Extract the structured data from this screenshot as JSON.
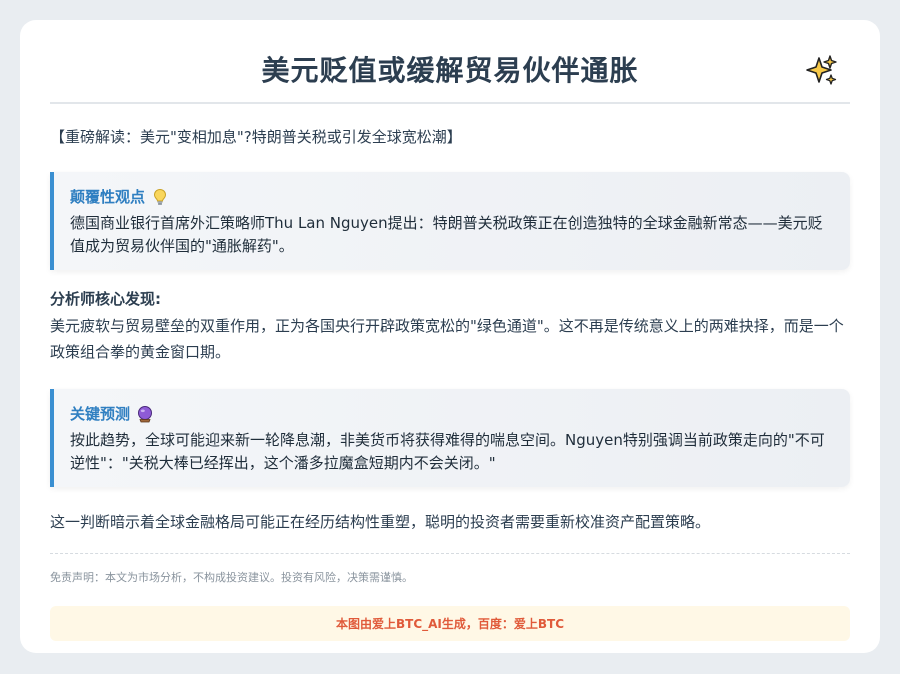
{
  "header": {
    "title": "美元贬值或缓解贸易伙伴通胀",
    "icon": "sparkles-icon"
  },
  "intro": "【重磅解读：美元\"变相加息\"?特朗普关税或引发全球宽松潮】",
  "callout_viewpoint": {
    "heading": "颠覆性观点",
    "icon": "lightbulb-icon",
    "body": "德国商业银行首席外汇策略师Thu Lan Nguyen提出：特朗普关税政策正在创造独特的全球金融新常态——美元贬值成为贸易伙伴国的\"通胀解药\"。"
  },
  "findings": {
    "heading": "分析师核心发现:",
    "body": "美元疲软与贸易壁垒的双重作用，正为各国央行开辟政策宽松的\"绿色通道\"。这不再是传统意义上的两难抉择，而是一个政策组合拳的黄金窗口期。"
  },
  "callout_forecast": {
    "heading": "关键预测",
    "icon": "crystal-ball-icon",
    "body": "按此趋势，全球可能迎来新一轮降息潮，非美货币将获得难得的喘息空间。Nguyen特别强调当前政策走向的\"不可逆性\"：\"关税大棒已经挥出，这个潘多拉魔盒短期内不会关闭。\""
  },
  "closing": "这一判断暗示着全球金融格局可能正在经历结构性重塑，聪明的投资者需要重新校准资产配置策略。",
  "disclaimer": "免责声明：本文为市场分析，不构成投资建议。投资有风险，决策需谨慎。",
  "notice": "本图由爱上BTC_AI生成，百度：爱上BTC",
  "colors": {
    "accent": "#3a8fd1",
    "heading_blue": "#2f7fc1",
    "notice_text": "#e05a3a",
    "notice_bg": "#fff8e6"
  }
}
